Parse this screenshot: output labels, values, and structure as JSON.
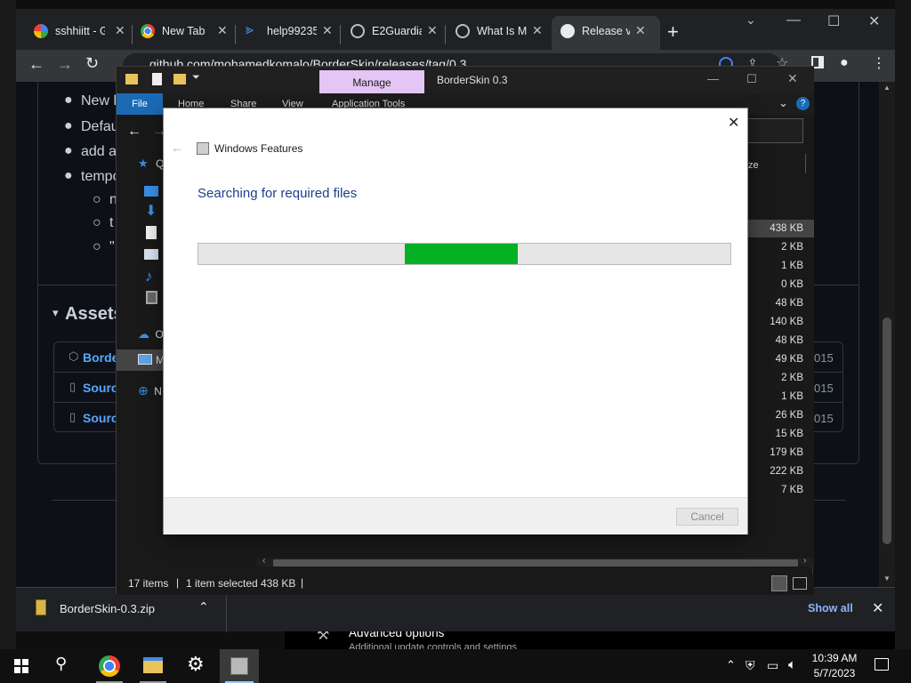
{
  "chrome": {
    "tabs": [
      {
        "label": "sshhiitt - G",
        "icon": "google-icon"
      },
      {
        "label": "New Tab",
        "icon": "chrome-icon"
      },
      {
        "label": "help99235",
        "icon": "zoho-icon"
      },
      {
        "label": "E2Guardia",
        "icon": "globe-icon"
      },
      {
        "label": "What Is M",
        "icon": "globe-icon"
      },
      {
        "label": "Release v0",
        "icon": "github-icon",
        "active": true
      }
    ],
    "new_tab": "+",
    "url": "github.com/mohamedkomalo/BorderSkin/releases/tag/0.3"
  },
  "github": {
    "bullets": [
      "New l",
      "Defau",
      "add a",
      "tempo"
    ],
    "sub_bullets": [
      "n",
      "t",
      "\""
    ],
    "assets_heading": "Assets",
    "assets": [
      {
        "name": "Borde",
        "icon": "package-icon",
        "date": "015"
      },
      {
        "name": "Source",
        "icon": "zip-icon",
        "date": "015"
      },
      {
        "name": "Source",
        "icon": "zip-icon",
        "date": "015"
      }
    ]
  },
  "explorer": {
    "title": "BorderSkin 0.3",
    "manage_label": "Manage",
    "ribbon_tabs": [
      "File",
      "Home",
      "Share",
      "View",
      "Application Tools"
    ],
    "column_header": "ze",
    "sidebar_items": [
      {
        "label": "Q",
        "icon": "quick-access-icon"
      },
      {
        "label": "",
        "icon": "desktop-folder-icon"
      },
      {
        "label": "",
        "icon": "downloads-icon"
      },
      {
        "label": "",
        "icon": "documents-icon"
      },
      {
        "label": "",
        "icon": "pictures-icon"
      },
      {
        "label": "",
        "icon": "music-icon"
      },
      {
        "label": "",
        "icon": "videos-icon"
      },
      {
        "label": "O",
        "icon": "onedrive-icon"
      },
      {
        "label": "M",
        "icon": "this-pc-icon"
      },
      {
        "label": "N",
        "icon": "network-icon"
      }
    ],
    "sizes": [
      "438 KB",
      "2 KB",
      "1 KB",
      "0 KB",
      "48 KB",
      "140 KB",
      "48 KB",
      "49 KB",
      "2 KB",
      "1 KB",
      "26 KB",
      "15 KB",
      "179 KB",
      "222 KB",
      "7 KB"
    ],
    "status": {
      "items": "17 items",
      "selected": "1 item selected",
      "size": "438 KB"
    }
  },
  "dialog": {
    "title": "Windows Features",
    "heading": "Searching for required files",
    "cancel": "Cancel"
  },
  "download": {
    "file": "BorderSkin-0.3.zip",
    "show_all": "Show all"
  },
  "background_settings": {
    "text": "Advanced options",
    "subtext": "Additional update controls and settings"
  },
  "taskbar": {
    "time": "10:39 AM",
    "date": "5/7/2023"
  },
  "colors": {
    "accent": "#1b6ab6",
    "progress": "#06b025",
    "manage_tab": "#e3c6f5",
    "dialog_heading": "#1e3f8a",
    "link": "#58a6ff"
  }
}
